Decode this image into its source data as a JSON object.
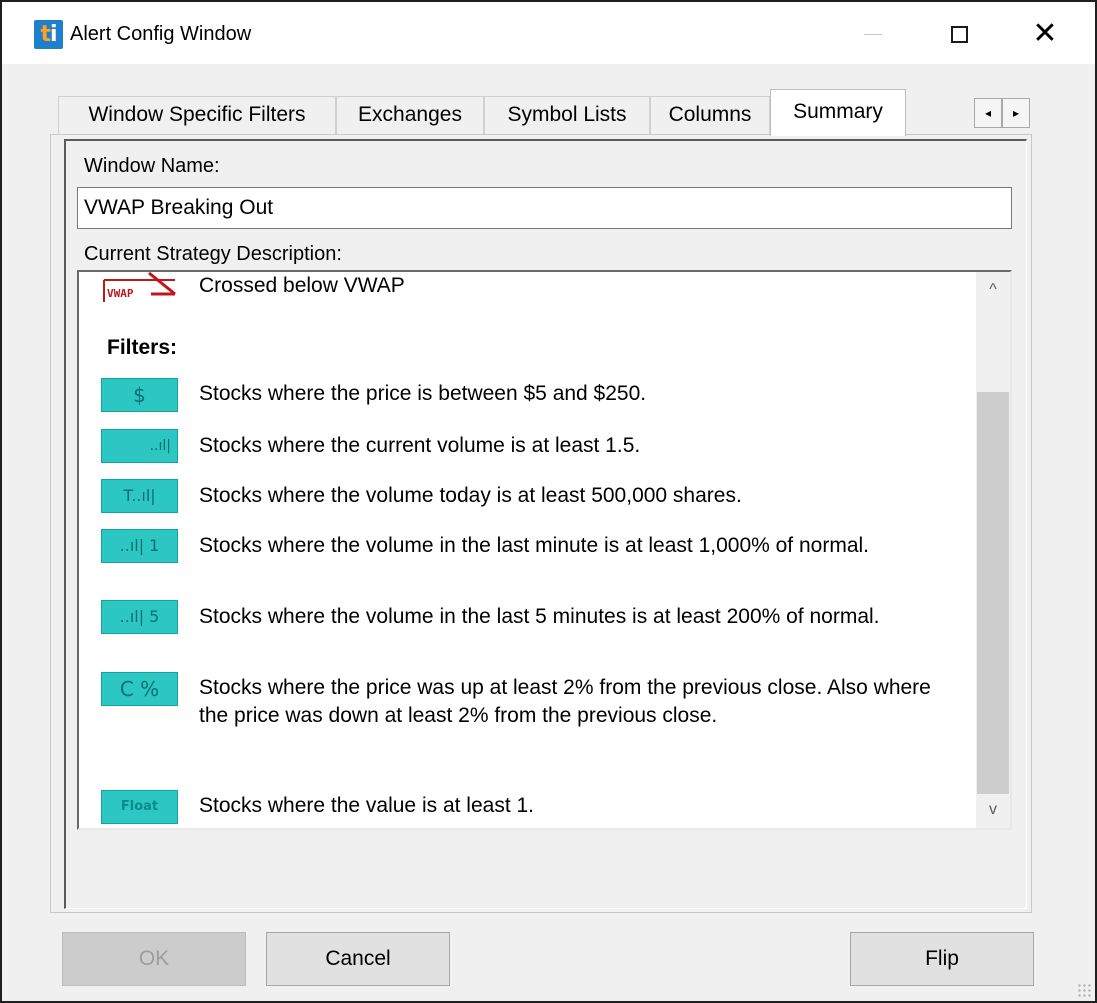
{
  "window": {
    "title": "Alert Config Window",
    "app_icon_text": "ti"
  },
  "tabs": [
    {
      "label": "Window Specific Filters",
      "active": false
    },
    {
      "label": "Exchanges",
      "active": false
    },
    {
      "label": "Symbol Lists",
      "active": false
    },
    {
      "label": "Columns",
      "active": false
    },
    {
      "label": "Summary",
      "active": true
    }
  ],
  "tab_scroll": {
    "left": "◂",
    "right": "▸"
  },
  "summary": {
    "window_name_label": "Window Name:",
    "window_name_value": "VWAP Breaking Out",
    "description_label": "Current Strategy Description:",
    "alert": {
      "icon": "vwap-cross-icon",
      "icon_text": "VWAP",
      "text": "Crossed below VWAP"
    },
    "filters_heading": "Filters:",
    "filters": [
      {
        "icon": "price-dollar-icon",
        "icon_text": "$",
        "text": "Stocks where the price is between $5 and $250."
      },
      {
        "icon": "volume-bars-icon",
        "icon_text": "..ıl|",
        "text": "Stocks where the current volume is at least 1.5."
      },
      {
        "icon": "volume-today-icon",
        "icon_text": "T..ıl|",
        "text": "Stocks where the volume today is at least 500,000 shares."
      },
      {
        "icon": "volume-1min-icon",
        "icon_text": "..ıl| 1",
        "text": "Stocks where the volume in the last minute is at least 1,000% of normal."
      },
      {
        "icon": "volume-5min-icon",
        "icon_text": "..ıl| 5",
        "text": "Stocks where the volume in the last 5 minutes is at least 200% of normal."
      },
      {
        "icon": "change-percent-icon",
        "icon_text": "C %",
        "text": "Stocks where the price was up at least 2% from the previous close. Also where the price was down at least 2% from the previous close."
      },
      {
        "icon": "float-icon",
        "icon_text": "Float",
        "text": "Stocks where the value is at least 1."
      }
    ]
  },
  "scrollbar": {
    "up": "^",
    "down": "v"
  },
  "buttons": {
    "ok": {
      "label": "OK",
      "enabled": false
    },
    "cancel": {
      "label": "Cancel",
      "enabled": true
    },
    "flip": {
      "label": "Flip",
      "enabled": true
    }
  },
  "colors": {
    "filter_icon_bg": "#2cc7c2",
    "vwap_icon_red": "#c0161c",
    "app_icon_blue": "#1f7fcf"
  }
}
